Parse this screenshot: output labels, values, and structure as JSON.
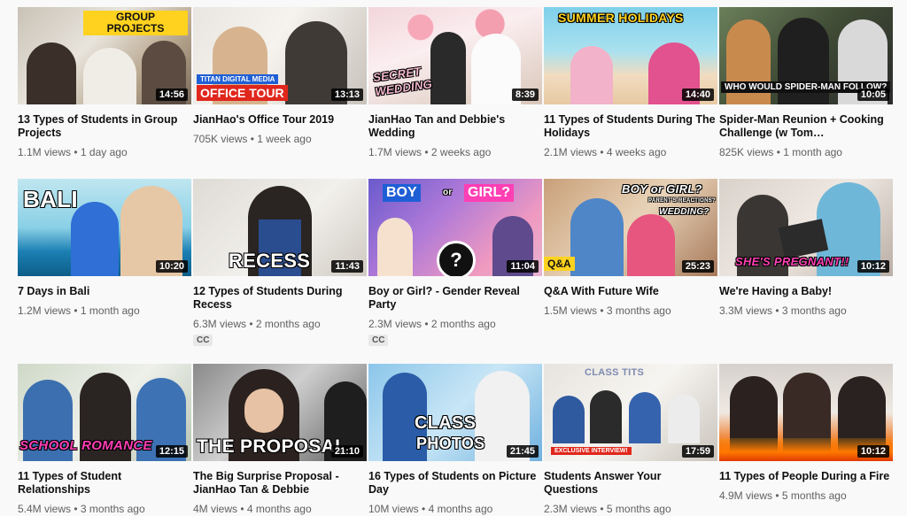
{
  "videos": [
    {
      "title": "13 Types of Students in Group Projects",
      "views": "1.1M views",
      "age": "1 day ago",
      "duration": "14:56",
      "caption": "GROUP PROJECTS",
      "cc": ""
    },
    {
      "title": "JianHao's Office Tour 2019",
      "views": "705K views",
      "age": "1 week ago",
      "duration": "13:13",
      "caption": "OFFICE TOUR",
      "subcaption": "TITAN DIGITAL MEDIA",
      "cc": ""
    },
    {
      "title": "JianHao Tan and Debbie's Wedding",
      "views": "1.7M views",
      "age": "2 weeks ago",
      "duration": "8:39",
      "caption": "SECRET WEDDING",
      "cc": ""
    },
    {
      "title": "11 Types of Students During The Holidays",
      "views": "2.1M views",
      "age": "4 weeks ago",
      "duration": "14:40",
      "caption": "SUMMER HOLIDAYS",
      "cc": ""
    },
    {
      "title": "Spider-Man Reunion + Cooking Challenge (w Tom…",
      "views": "825K views",
      "age": "1 month ago",
      "duration": "10:05",
      "caption": "WHO WOULD SPIDER-MAN FOLLOW?",
      "cc": ""
    },
    {
      "title": "7 Days in Bali",
      "views": "1.2M views",
      "age": "1 month ago",
      "duration": "10:20",
      "caption": "BALI",
      "cc": ""
    },
    {
      "title": "12 Types of Students During Recess",
      "views": "6.3M views",
      "age": "2 months ago",
      "duration": "11:43",
      "caption": "RECESS",
      "cc": "CC"
    },
    {
      "title": "Boy or Girl? - Gender Reveal Party",
      "views": "2.3M views",
      "age": "2 months ago",
      "duration": "11:04",
      "caption": "BOY",
      "caption2": "GIRL?",
      "mid": "or",
      "cc": "CC"
    },
    {
      "title": "Q&A With Future Wife",
      "views": "1.5M views",
      "age": "3 months ago",
      "duration": "25:23",
      "caption": "BOY or GIRL?",
      "subcaption": "PARENT'S REACTIONS?",
      "caption2": "WEDDING?",
      "tagtext": "Q&A",
      "cc": ""
    },
    {
      "title": "We're Having a Baby!",
      "views": "3.3M views",
      "age": "3 months ago",
      "duration": "10:12",
      "caption": "SHE'S PREGNANT!!",
      "cc": ""
    },
    {
      "title": "11 Types of Student Relationships",
      "views": "5.4M views",
      "age": "3 months ago",
      "duration": "12:15",
      "caption": "SCHOOL ROMANCE",
      "cc": ""
    },
    {
      "title": "The Big Surprise Proposal - JianHao Tan & Debbie",
      "views": "4M views",
      "age": "4 months ago",
      "duration": "21:10",
      "caption": "THE PROPOSAL",
      "cc": ""
    },
    {
      "title": "16 Types of Students on Picture Day",
      "views": "10M views",
      "age": "4 months ago",
      "duration": "21:45",
      "caption": "CLASS",
      "caption2": "PHOTOS",
      "cc": ""
    },
    {
      "title": "Students Answer Your Questions",
      "views": "2.3M views",
      "age": "5 months ago",
      "duration": "17:59",
      "caption": "EXCLUSIVE INTERVIEW!",
      "caption2": "CLASS TITS",
      "cc": ""
    },
    {
      "title": "11 Types of People During a Fire",
      "views": "4.9M views",
      "age": "5 months ago",
      "duration": "10:12",
      "caption": "",
      "cc": ""
    }
  ],
  "separator": "•",
  "colors": {
    "accent_yellow": "#ffd21f",
    "accent_red": "#e0271c",
    "accent_pink": "#ff3fb4",
    "accent_blue": "#1f5fd6"
  }
}
